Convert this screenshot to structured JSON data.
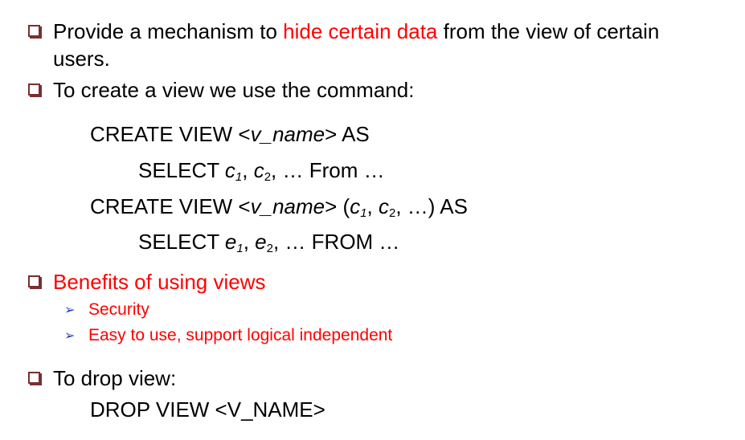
{
  "colors": {
    "highlight": "#ff0000",
    "bullet_box": "#7a2f2f",
    "arrow": "#1f3fbf"
  },
  "bullet1": {
    "before": "Provide a mechanism to ",
    "highlight": "hide certain data",
    "after": " from the view of certain",
    "line2": "users."
  },
  "bullet2": {
    "text": "To create a view we use the command:"
  },
  "code1": {
    "l1_prefix": "CREATE VIEW <",
    "l1_name": "v_name",
    "l1_suffix": "> AS",
    "l2_select": "SELECT ",
    "c": "c",
    "sub1": "1",
    "sub2": "2",
    "l2_tail": ", … From …"
  },
  "code2": {
    "l1_prefix": "CREATE VIEW <",
    "l1_name": "v_name",
    "l1_mid": "> (",
    "c": "c",
    "sub1": "1",
    "sub2": "2",
    "l1_tail": ", …) AS",
    "l2_select": "SELECT ",
    "e": "e",
    "l2_tail": ", … FROM …"
  },
  "bullet3": {
    "text": "Benefits of using views",
    "subitems": [
      "Security",
      "Easy to use, support logical independent"
    ]
  },
  "bullet4": {
    "text": "To drop view:",
    "code": "DROP VIEW <V_NAME>"
  }
}
